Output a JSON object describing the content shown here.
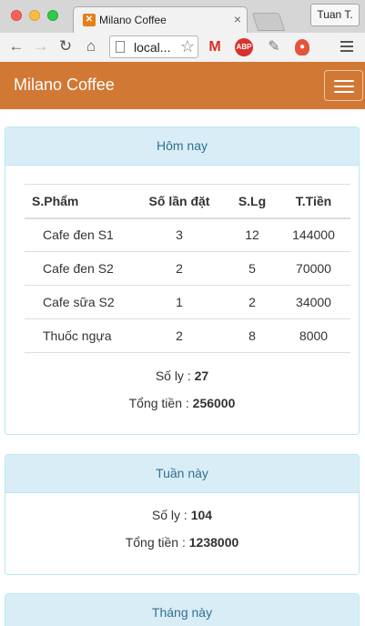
{
  "browser": {
    "tab_title": "Milano Coffee",
    "tab_close": "×",
    "profile_name": "Tuan T.",
    "url": "local...",
    "extensions": [
      "gmail-icon",
      "adblock-plus-icon",
      "tool-icon",
      "lightbulb-icon"
    ],
    "abp_label": "ABP"
  },
  "navbar": {
    "brand": "Milano Coffee",
    "color": "#d07834"
  },
  "today": {
    "heading": "Hôm nay",
    "columns": [
      "S.Phẩm",
      "Số lần đặt",
      "S.Lg",
      "T.Tiền"
    ],
    "rows": [
      [
        "Cafe đen S1",
        "3",
        "12",
        "144000"
      ],
      [
        "Cafe đen S2",
        "2",
        "5",
        "70000"
      ],
      [
        "Cafe sữa S2",
        "1",
        "2",
        "34000"
      ],
      [
        "Thuốc ngựa",
        "2",
        "8",
        "8000"
      ]
    ],
    "cups_label": "Số ly :",
    "cups_value": "27",
    "total_label": "Tổng tiền :",
    "total_value": "256000"
  },
  "week": {
    "heading": "Tuần này",
    "cups_label": "Số ly :",
    "cups_value": "104",
    "total_label": "Tổng tiền :",
    "total_value": "1238000"
  },
  "month": {
    "heading": "Tháng này"
  },
  "colors": {
    "panel_heading_bg": "#d9edf7",
    "panel_heading_text": "#31708f",
    "panel_border": "#bce8f1"
  }
}
